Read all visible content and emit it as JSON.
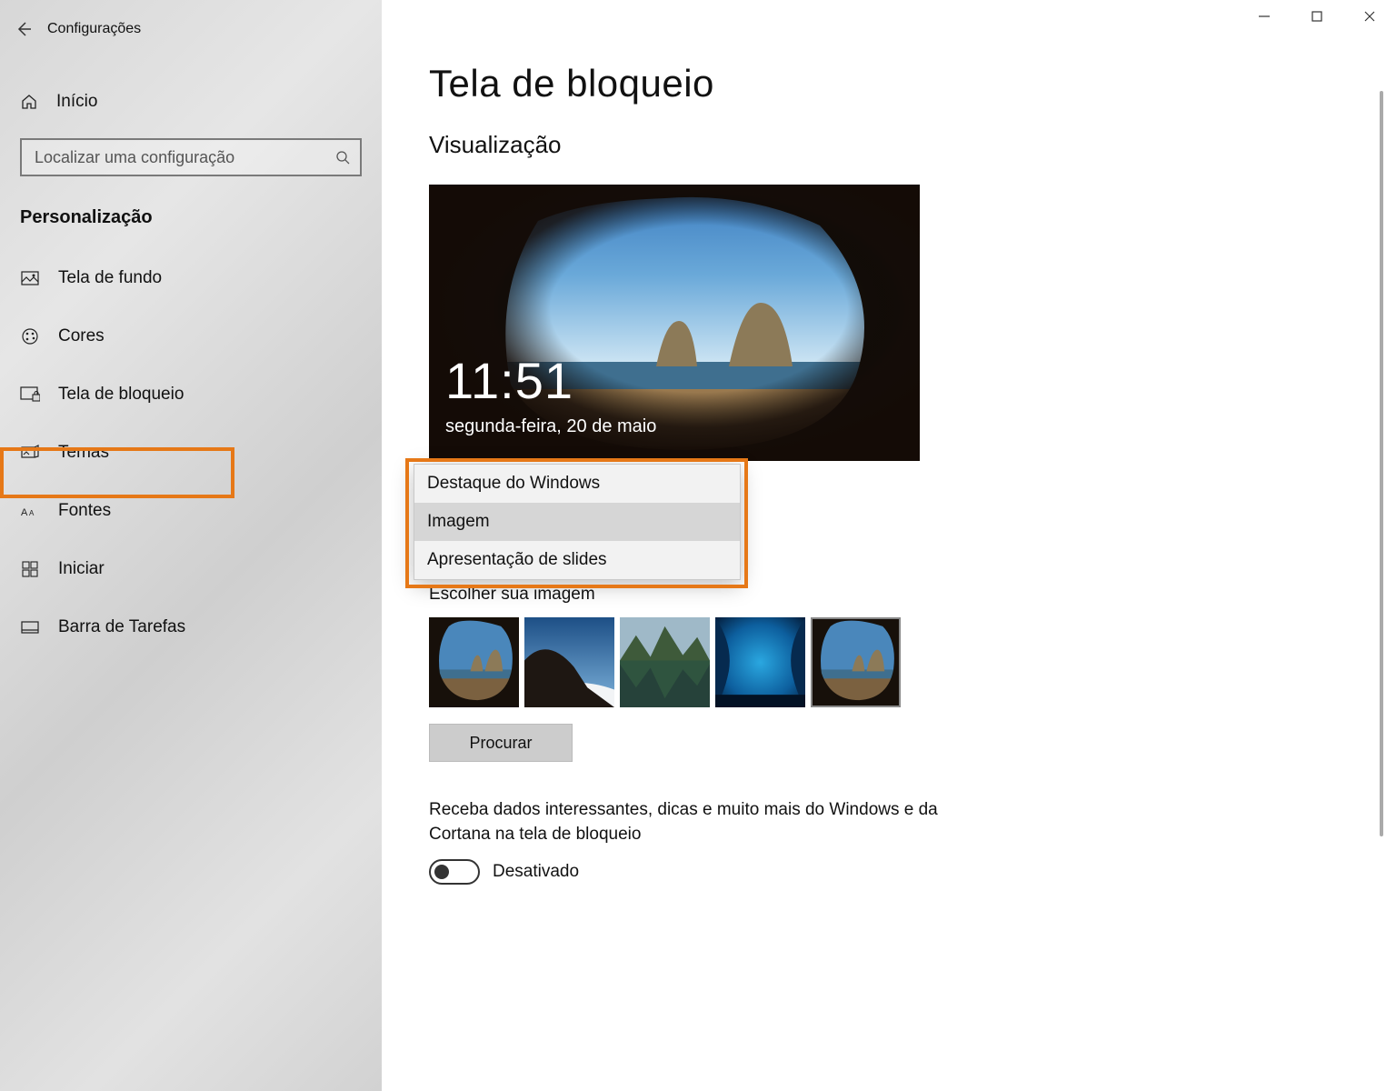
{
  "header": {
    "title": "Configurações"
  },
  "home": {
    "label": "Início"
  },
  "search": {
    "placeholder": "Localizar uma configuração"
  },
  "category": "Personalização",
  "nav": {
    "items": [
      {
        "label": "Tela de fundo"
      },
      {
        "label": "Cores"
      },
      {
        "label": "Tela de bloqueio"
      },
      {
        "label": "Temas"
      },
      {
        "label": "Fontes"
      },
      {
        "label": "Iniciar"
      },
      {
        "label": "Barra de Tarefas"
      }
    ]
  },
  "page": {
    "title": "Tela de bloqueio",
    "preview_section": "Visualização",
    "preview_time": "11:51",
    "preview_date": "segunda-feira, 20 de maio",
    "choose_image_label": "Escolher sua imagem",
    "browse_button": "Procurar",
    "tip_text": "Receba dados interessantes, dicas e muito mais do Windows e da Cortana na tela de bloqueio",
    "toggle_label": "Desativado"
  },
  "dropdown": {
    "options": [
      "Destaque do Windows",
      "Imagem",
      "Apresentação de slides"
    ]
  }
}
